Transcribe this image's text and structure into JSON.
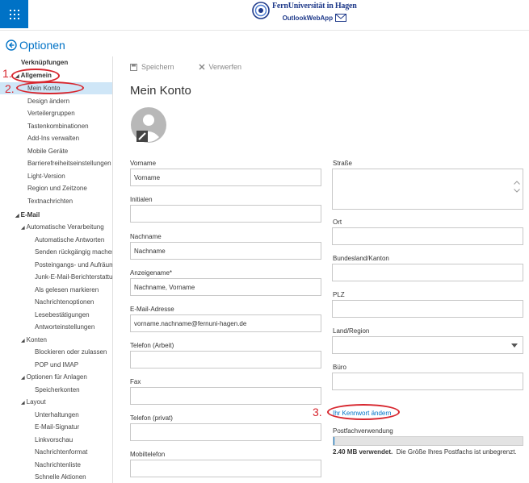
{
  "header": {
    "brand_name": "FernUniversität in Hagen",
    "app_name": "OutlookWebApp"
  },
  "options": {
    "title": "Optionen"
  },
  "sidebar": {
    "items": [
      {
        "label": "Verknüpfungen"
      },
      {
        "label": "Allgemein"
      },
      {
        "label": "Mein Konto"
      },
      {
        "label": "Design ändern"
      },
      {
        "label": "Verteilergruppen"
      },
      {
        "label": "Tastenkombinationen"
      },
      {
        "label": "Add-Ins verwalten"
      },
      {
        "label": "Mobile Geräte"
      },
      {
        "label": "Barrierefreiheitseinstellungen"
      },
      {
        "label": "Light-Version"
      },
      {
        "label": "Region und Zeitzone"
      },
      {
        "label": "Textnachrichten"
      },
      {
        "label": "E-Mail"
      },
      {
        "label": "Automatische Verarbeitung"
      },
      {
        "label": "Automatische Antworten"
      },
      {
        "label": "Senden rückgängig machen"
      },
      {
        "label": "Posteingangs- und Aufräumregeln"
      },
      {
        "label": "Junk-E-Mail-Berichterstattung"
      },
      {
        "label": "Als gelesen markieren"
      },
      {
        "label": "Nachrichtenoptionen"
      },
      {
        "label": "Lesebestätigungen"
      },
      {
        "label": "Antworteinstellungen"
      },
      {
        "label": "Konten"
      },
      {
        "label": "Blockieren oder zulassen"
      },
      {
        "label": "POP und IMAP"
      },
      {
        "label": "Optionen für Anlagen"
      },
      {
        "label": "Speicherkonten"
      },
      {
        "label": "Layout"
      },
      {
        "label": "Unterhaltungen"
      },
      {
        "label": "E-Mail-Signatur"
      },
      {
        "label": "Linkvorschau"
      },
      {
        "label": "Nachrichtenformat"
      },
      {
        "label": "Nachrichtenliste"
      },
      {
        "label": "Schnelle Aktionen"
      }
    ]
  },
  "toolbar": {
    "save_label": "Speichern",
    "discard_label": "Verwerfen"
  },
  "main": {
    "title": "Mein Konto",
    "left_fields": [
      {
        "label": "Vorname",
        "value": "Vorname"
      },
      {
        "label": "Initialen",
        "value": ""
      },
      {
        "label": "Nachname",
        "value": "Nachname"
      },
      {
        "label": "Anzeigename",
        "required": "*",
        "value": "Nachname, Vorname"
      },
      {
        "label": "E-Mail-Adresse",
        "value": "vorname.nachname@fernuni-hagen.de"
      },
      {
        "label": "Telefon (Arbeit)",
        "value": ""
      },
      {
        "label": "Fax",
        "value": ""
      },
      {
        "label": "Telefon (privat)",
        "value": ""
      },
      {
        "label": "Mobiltelefon",
        "value": ""
      }
    ],
    "right_fields": {
      "street": {
        "label": "Straße",
        "value": ""
      },
      "city": {
        "label": "Ort",
        "value": ""
      },
      "state": {
        "label": "Bundesland/Kanton",
        "value": ""
      },
      "zip": {
        "label": "PLZ",
        "value": ""
      },
      "country": {
        "label": "Land/Region",
        "value": ""
      },
      "office": {
        "label": "Büro",
        "value": ""
      }
    },
    "password_link": "Ihr Kennwort ändern",
    "quota": {
      "label": "Postfachverwendung",
      "used": "2.40 MB verwendet.",
      "note": "Die Größe Ihres Postfachs ist unbegrenzt.",
      "fill_fraction": 0.005
    }
  },
  "annotations": {
    "one": "1.",
    "two": "2.",
    "three": "3."
  },
  "colors": {
    "accent": "#0072c6",
    "annotation": "#d7262e",
    "selected": "#cfe6f7"
  },
  "icons": [
    "app-launcher-icon",
    "university-logo-icon",
    "mail-icon",
    "back-arrow-icon",
    "save-icon",
    "discard-icon",
    "avatar-icon",
    "edit-pencil-icon",
    "dropdown-icon",
    "scroll-up-icon",
    "scroll-down-icon"
  ]
}
